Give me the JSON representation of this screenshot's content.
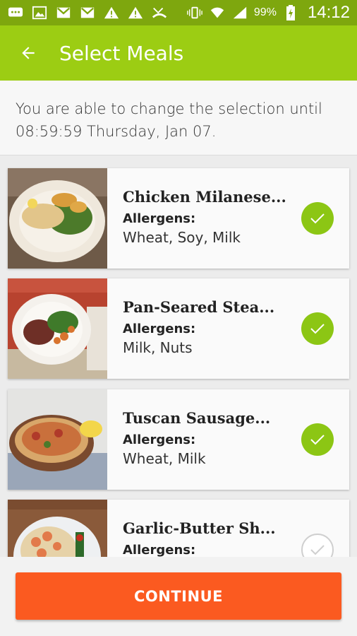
{
  "status_bar": {
    "left_icons": [
      "chat-icon",
      "image-icon",
      "gmail-icon",
      "gmail-icon",
      "warning-icon",
      "warning-icon",
      "missed-call-icon"
    ],
    "right_icons": [
      "vibrate-icon",
      "wifi-icon",
      "signal-icon",
      "battery-charging-icon"
    ],
    "battery": "99%",
    "time": "14:12"
  },
  "header": {
    "title": "Select Meals",
    "back_icon": "arrow-left-icon",
    "color": "#9ccd13"
  },
  "notice": {
    "text_line1": "You are able to change the selection until",
    "text_line2": "08:59:59 Thursday, Jan 07."
  },
  "meals": [
    {
      "name": "Chicken Milanese...",
      "allergens_label": "Allergens:",
      "allergens": "Wheat, Soy, Milk",
      "selected": true
    },
    {
      "name": "Pan-Seared Stea...",
      "allergens_label": "Allergens:",
      "allergens": "Milk, Nuts",
      "selected": true
    },
    {
      "name": "Tuscan Sausage...",
      "allergens_label": "Allergens:",
      "allergens": "Wheat, Milk",
      "selected": true
    },
    {
      "name": "Garlic-Butter Sh...",
      "allergens_label": "Allergens:",
      "allergens": "",
      "selected": false
    }
  ],
  "footer": {
    "continue_label": "CONTINUE",
    "color": "#fb5a20"
  }
}
